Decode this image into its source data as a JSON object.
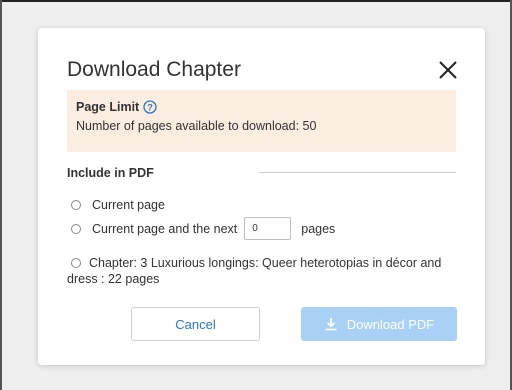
{
  "dialog": {
    "title": "Download Chapter",
    "close_icon": "close-icon"
  },
  "page_limit": {
    "label": "Page Limit",
    "help_icon": "help-circle-icon",
    "text": "Number of pages available to download: 50"
  },
  "include": {
    "heading": "Include in PDF",
    "options": [
      {
        "label": "Current page",
        "selected": false
      },
      {
        "label_before": "Current page and the next",
        "value": "0",
        "label_after": "pages",
        "selected": false
      },
      {
        "label": "Chapter: 3 Luxurious longings: Queer heterotopias in décor and dress : 22 pages",
        "selected": false
      }
    ]
  },
  "buttons": {
    "cancel": "Cancel",
    "download": "Download PDF",
    "download_icon": "download-icon",
    "download_enabled": false
  },
  "colors": {
    "accent": "#2b78c2",
    "notice_bg": "#fbeee0",
    "disabled_primary": "#a9d0f5"
  }
}
